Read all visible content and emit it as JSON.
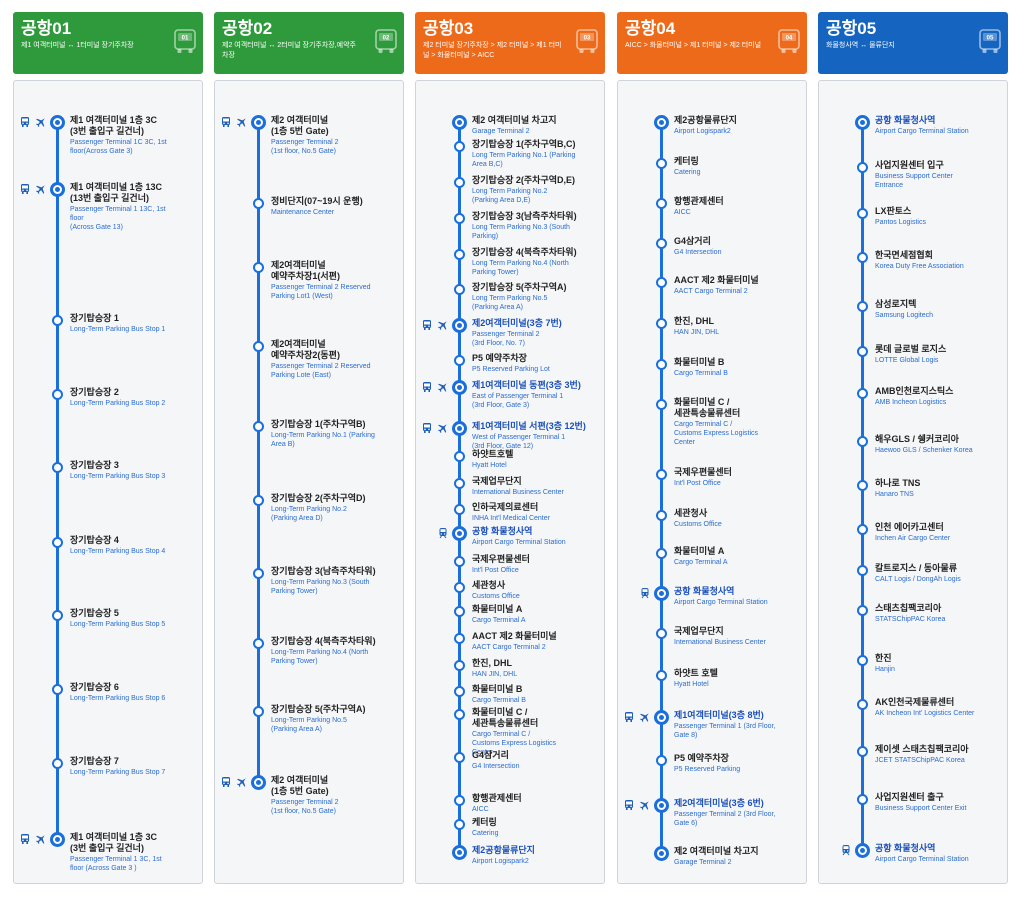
{
  "colors": {
    "green": "#2f9a3c",
    "orange": "#ee6a1b",
    "blue": "#1565c0",
    "line": "#1a6fdc",
    "icon_blue": "#1f5fb8"
  },
  "icon_names": [
    "bus-icon",
    "airplane-icon",
    "train-icon"
  ],
  "routes": [
    {
      "title": "공항01",
      "subtitle": "제1 여객터미널 ↔ 1터미널 장기주차장",
      "badge": "01",
      "color": "#2f9a3c",
      "stops": [
        {
          "ko": "제1 여객터미널 1층 3C\n(3번 출입구 길건너)",
          "en": "Passenger Terminal 1C 3C, 1st\nfloor(Across Gate 3)",
          "major": true,
          "transfer": true
        },
        {
          "ko": "제1 여객터미널 1층 13C\n(13번 출입구 길건너)",
          "en": "Passenger Terminal 1 13C, 1st\nfloor\n(Across Gate 13)",
          "major": true,
          "transfer": true
        },
        {
          "ko": "장기탑승장 1",
          "en": "Long-Term Parking Bus Stop 1"
        },
        {
          "ko": "장기탑승장 2",
          "en": "Long-Term Parking Bus Stop 2"
        },
        {
          "ko": "장기탑승장 3",
          "en": "Long-Term Parking Bus Stop 3"
        },
        {
          "ko": "장기탑승장 4",
          "en": "Long-Term Parking Bus Stop 4"
        },
        {
          "ko": "장기탑승장 5",
          "en": "Long-Term Parking Bus Stop 5"
        },
        {
          "ko": "장기탑승장 6",
          "en": "Long-Term Parking Bus Stop 6"
        },
        {
          "ko": "장기탑승장 7",
          "en": "Long-Term Parking Bus Stop 7"
        },
        {
          "ko": "제1 여객터미널 1층 3C\n(3번 출입구 길건너)",
          "en": "Passenger Terminal 1 3C, 1st\nfloor (Across Gate 3 )",
          "major": true,
          "transfer": true
        }
      ]
    },
    {
      "title": "공항02",
      "subtitle": "제2 여객터미널 ↔ 2터미널 장기주차장,예약주차장",
      "badge": "02",
      "color": "#2f9a3c",
      "stops": [
        {
          "ko": "제2 여객터미널\n(1층 5번 Gate)",
          "en": "Passenger Terminal 2\n(1st floor, No.5 Gate)",
          "major": true,
          "transfer": true
        },
        {
          "ko": "정비단지(07~19시 운행)",
          "en": "Maintenance Center"
        },
        {
          "ko": "제2여객터미널\n예약주차장1(서편)",
          "en": "Passenger Terminal 2 Reserved\nParking Lot1 (West)"
        },
        {
          "ko": "제2여객터미널\n예약주차장2(동편)",
          "en": "Passenger Terminal 2 Reserved\nParking Lote (East)"
        },
        {
          "ko": "장기탑승장 1(주차구역B)",
          "en": "Long-Term Parking No.1 (Parking\nArea B)"
        },
        {
          "ko": "장기탑승장 2(주차구역D)",
          "en": "Long-Term Parking No.2\n(Parking Area D)"
        },
        {
          "ko": "장기탑승장 3(남측주차타워)",
          "en": "Long-Term Parking No.3 (South\nParking Tower)"
        },
        {
          "ko": "장기탑승장 4(북측주차타워)",
          "en": "Long-Term Parking No.4 (North\nParking Tower)"
        },
        {
          "ko": "장기탑승장 5(주차구역A)",
          "en": "Long-Term Parking No.5\n(Parking Area A)"
        },
        {
          "ko": "제2 여객터미널\n(1층 5번 Gate)",
          "en": "Passenger Terminal 2\n(1st floor, No.5 Gate)",
          "major": true,
          "transfer": true
        }
      ]
    },
    {
      "title": "공항03",
      "subtitle": "제2 터미널 장기주차장 > 제2 터미널 > 제1 터미널 > 화물터미널 > AICC",
      "badge": "03",
      "color": "#ee6a1b",
      "stops": [
        {
          "ko": "제2 여객터미널 차고지",
          "en": "Garage Terminal 2",
          "major": true
        },
        {
          "ko": "장기탑승장 1(주차구역B,C)",
          "en": "Long Term Parking No.1 (Parking\nArea B,C)"
        },
        {
          "ko": "장기탑승장 2(주차구역D,E)",
          "en": "Long Term Parking No.2\n(Parking Area D,E)"
        },
        {
          "ko": "장기탑승장 3(남측주차타워)",
          "en": "Long Term Parking No.3 (South\nParking)"
        },
        {
          "ko": "장기탑승장 4(북측주차타워)",
          "en": "Long Term Parking No.4 (North\nParking Tower)"
        },
        {
          "ko": "장기탑승장 5(주차구역A)",
          "en": "Long Term Parking No.5\n(Parking Area A)"
        },
        {
          "ko": "제2여객터미널(3층 7번)",
          "en": "Passenger Terminal 2\n(3rd Floor, No. 7)",
          "major": true,
          "transfer": true,
          "hl": true
        },
        {
          "ko": "P5 예약주차장",
          "en": "P5 Reserved Parking Lot"
        },
        {
          "ko": "제1여객터미널 동편(3층 3번)",
          "en": "East of Passenger Terminal 1\n(3rd Floor, Gate 3)",
          "major": true,
          "transfer": true,
          "hl": true
        },
        {
          "ko": "제1여객터미널 서편(3층 12번)",
          "en": "West of Passenger Terminal 1\n(3rd Floor, Gate 12)",
          "major": true,
          "transfer": true,
          "hl": true
        },
        {
          "ko": "하얏트호텔",
          "en": "Hyatt Hotel"
        },
        {
          "ko": "국제업무단지",
          "en": "International Business Center"
        },
        {
          "ko": "인하국제의료센터",
          "en": "INHA Int'l Medical Center"
        },
        {
          "ko": "공항 화물청사역",
          "en": "Airport Cargo Terminal Station",
          "major": true,
          "train": true,
          "hl": true
        },
        {
          "ko": "국제우편물센터",
          "en": "Int'l Post Office"
        },
        {
          "ko": "세관청사",
          "en": "Customs Office"
        },
        {
          "ko": "화물터미널 A",
          "en": "Cargo Terminal A"
        },
        {
          "ko": "AACT 제2 화물터미널",
          "en": "AACT Cargo Terminal 2"
        },
        {
          "ko": "한진, DHL",
          "en": "HAN JIN, DHL"
        },
        {
          "ko": "화물터미널 B",
          "en": "Cargo Terminal B"
        },
        {
          "ko": "화물터미널 C /\n세관특송물류센터",
          "en": "Cargo Terminal C /\nCustoms Express Logistics\nCenter"
        },
        {
          "ko": "G4삼거리",
          "en": "G4 Intersection"
        },
        {
          "ko": "항행관제센터",
          "en": "AICC"
        },
        {
          "ko": "케터링",
          "en": "Catering"
        },
        {
          "ko": "제2공항물류단지",
          "en": "Airport Logispark2",
          "major": true,
          "hl": true
        }
      ]
    },
    {
      "title": "공항04",
      "subtitle": "AICC > 화물터미널 > 제1 터미널 > 제2 터미널",
      "badge": "04",
      "color": "#ee6a1b",
      "stops": [
        {
          "ko": "제2공항물류단지",
          "en": "Airport Logispark2",
          "major": true
        },
        {
          "ko": "케터링",
          "en": "Catering"
        },
        {
          "ko": "항행관제센터",
          "en": "AICC"
        },
        {
          "ko": "G4삼거리",
          "en": "G4 Intersection"
        },
        {
          "ko": "AACT 제2 화물터미널",
          "en": "AACT Cargo Terminal 2"
        },
        {
          "ko": "한진, DHL",
          "en": "HAN JIN, DHL"
        },
        {
          "ko": "화물터미널 B",
          "en": "Cargo Terminal B"
        },
        {
          "ko": "화물터미널 C /\n세관특송물류센터",
          "en": "Cargo Terminal C /\nCustoms Express Logistics\nCenter"
        },
        {
          "ko": "국제우편물센터",
          "en": "Int'l Post Office"
        },
        {
          "ko": "세관청사",
          "en": "Customs Office"
        },
        {
          "ko": "화물터미널 A",
          "en": "Cargo Terminal A"
        },
        {
          "ko": "공항 화물청사역",
          "en": "Airport Cargo Terminal Station",
          "major": true,
          "train": true,
          "hl": true
        },
        {
          "ko": "국제업무단지",
          "en": "International Business Center"
        },
        {
          "ko": "하얏트 호텔",
          "en": "Hyatt Hotel"
        },
        {
          "ko": "제1여객터미널(3층 8번)",
          "en": "Passenger Terminal 1 (3rd Floor,\nGate 8)",
          "major": true,
          "transfer": true,
          "hl": true
        },
        {
          "ko": "P5 예약주차장",
          "en": "P5 Reserved Parking"
        },
        {
          "ko": "제2여객터미널(3층 6번)",
          "en": "Passenger Terminal 2 (3rd Floor,\nGate 6)",
          "major": true,
          "transfer": true,
          "hl": true
        },
        {
          "ko": "제2 여객터미널 차고지",
          "en": "Garage Terminal 2",
          "major": true
        }
      ]
    },
    {
      "title": "공항05",
      "subtitle": "화물청사역 ↔ 물류단지",
      "badge": "05",
      "color": "#1565c0",
      "stops": [
        {
          "ko": "공항 화물청사역",
          "en": "Airport Cargo Terminal Station",
          "major": true,
          "hl": true
        },
        {
          "ko": "사업지원센터 입구",
          "en": "Business Support Center\nEntrance"
        },
        {
          "ko": "LX판토스",
          "en": "Pantos Logistics"
        },
        {
          "ko": "한국면세점협회",
          "en": "Korea Duty Free Association"
        },
        {
          "ko": "삼성로지텍",
          "en": "Samsung Logitech"
        },
        {
          "ko": "롯데 글로벌 로지스",
          "en": "LOTTE Global Logis"
        },
        {
          "ko": "AMB인천로지스틱스",
          "en": "AMB Incheon Logistics"
        },
        {
          "ko": "해우GLS / 쉥커코리아",
          "en": "Haewoo GLS / Schenker Korea"
        },
        {
          "ko": "하나로 TNS",
          "en": "Hanaro TNS"
        },
        {
          "ko": "인천 에어카고센터",
          "en": "Inchen Air Cargo Center"
        },
        {
          "ko": "칼트로지스 / 동아물류",
          "en": "CALT Logis / DongAh Logis"
        },
        {
          "ko": "스태츠칩팩코리아",
          "en": "STATSChipPAC Korea"
        },
        {
          "ko": "한진",
          "en": "Hanjin"
        },
        {
          "ko": "AK인천국제물류센터",
          "en": "AK Incheon Int' Logistics Center"
        },
        {
          "ko": "제이셋 스태츠칩팩코리아",
          "en": "JCET STATSChipPAC Korea"
        },
        {
          "ko": "사업지원센터 출구",
          "en": "Business Support Center Exit"
        },
        {
          "ko": "공항 화물청사역",
          "en": "Airport Cargo Terminal Station",
          "major": true,
          "train": true,
          "hl": true
        }
      ]
    }
  ]
}
